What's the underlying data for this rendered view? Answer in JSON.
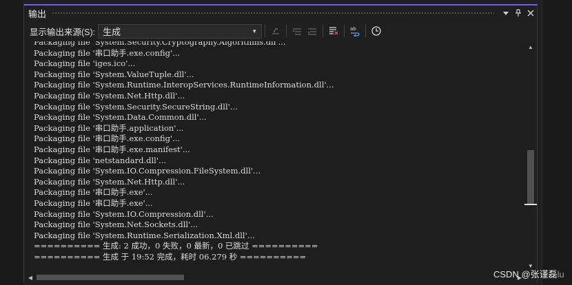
{
  "panel": {
    "title": "输出",
    "buttons": [
      {
        "name": "window-position-icon",
        "glyph": "▾"
      },
      {
        "name": "pin-icon",
        "glyph": "⊥"
      },
      {
        "name": "close-icon",
        "glyph": "✕"
      }
    ]
  },
  "toolbar": {
    "source_label": "显示输出来源(S):",
    "source_value": "生成",
    "icons": [
      "find-message-icon",
      "previous-message-icon",
      "next-message-icon",
      "clear-all-icon",
      "word-wrap-icon",
      "timestamp-icon"
    ]
  },
  "output": {
    "lines": [
      "Packaging file 'System.Security.Cryptography.Algorithms.dll'...",
      "Packaging file '串口助手.exe.config'...",
      "Packaging file 'iges.ico'...",
      "Packaging file 'System.ValueTuple.dll'...",
      "Packaging file 'System.Runtime.InteropServices.RuntimeInformation.dll'...",
      "Packaging file 'System.Net.Http.dll'...",
      "Packaging file 'System.Security.SecureString.dll'...",
      "Packaging file 'System.Data.Common.dll'...",
      "Packaging file '串口助手.application'...",
      "Packaging file '串口助手.exe.config'...",
      "Packaging file '串口助手.exe.manifest'...",
      "Packaging file 'netstandard.dll'...",
      "Packaging file 'System.IO.Compression.FileSystem.dll'...",
      "Packaging file 'System.Net.Http.dll'...",
      "Packaging file '串口助手.exe'...",
      "Packaging file '串口助手.exe'...",
      "Packaging file 'System.IO.Compression.dll'...",
      "Packaging file 'System.Net.Sockets.dll'...",
      "Packaging file 'System.Runtime.Serialization.Xml.dll'...",
      "========== 生成: 2 成功，0 失败，0 最新，0 已跳过 ==========",
      "========== 生成 于 19:52 完成，耗时 06.279 秒 =========="
    ]
  },
  "watermark": {
    "text": "CSDN @张谨磊",
    "tail": "lu"
  },
  "colors": {
    "accent": "#7160e8",
    "background": "#1e1e1e",
    "text": "#dcdcdc"
  }
}
